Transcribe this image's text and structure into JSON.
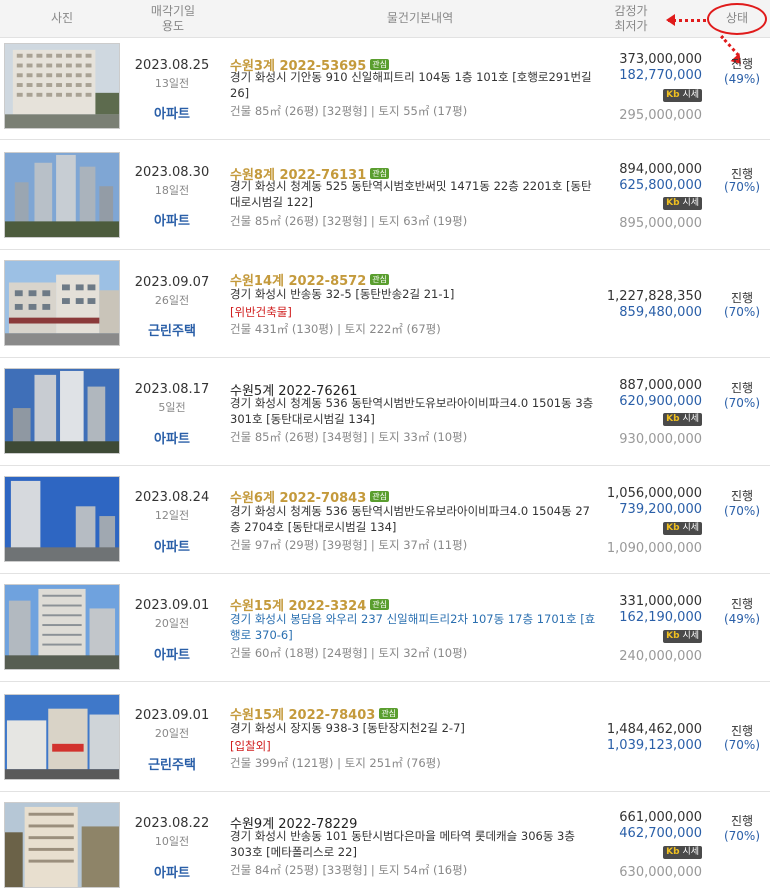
{
  "header": {
    "photo": "사진",
    "date_line1": "매각기일",
    "date_line2": "용도",
    "basic": "물건기본내역",
    "price_line1": "감정가",
    "price_line2": "최저가",
    "status": "상태"
  },
  "market_badge": {
    "kb": "Kb",
    "label": "시세"
  },
  "rows": [
    {
      "date": "2023.08.25",
      "days": "13일전",
      "usage": "아파트",
      "case": "수원3계 2022-53695",
      "tag": "관심",
      "addr": "경기 화성시 기안동 910 신일해피트리 104동 1층 101호 [호행로291번길 26]",
      "area": "건물 85㎡ (26평) [32평형]  |  토지 55㎡ (17평)",
      "appraisal": "373,000,000",
      "minimum": "182,770,000",
      "market": "295,000,000",
      "status": "진행",
      "pct": "(49%)"
    },
    {
      "date": "2023.08.30",
      "days": "18일전",
      "usage": "아파트",
      "case": "수원8계 2022-76131",
      "tag": "관심",
      "addr": "경기 화성시 청계동 525 동탄역시범호반써밋 1471동 22층 2201호 [동탄대로시범길 122]",
      "area": "건물 85㎡ (26평) [32평형]  |  토지 63㎡ (19평)",
      "appraisal": "894,000,000",
      "minimum": "625,800,000",
      "market": "895,000,000",
      "status": "진행",
      "pct": "(70%)"
    },
    {
      "date": "2023.09.07",
      "days": "26일전",
      "usage": "근린주택",
      "case": "수원14계 2022-8572",
      "tag": "관심",
      "addr": "경기 화성시 반송동 32-5 [동탄반송2길 21-1]",
      "warn": "[위반건축물]",
      "area": "건물 431㎡ (130평)  |  토지 222㎡ (67평)",
      "appraisal": "1,227,828,350",
      "minimum": "859,480,000",
      "status": "진행",
      "pct": "(70%)"
    },
    {
      "date": "2023.08.17",
      "days": "5일전",
      "usage": "아파트",
      "case": "수원5계 2022-76261",
      "addr": "경기 화성시 청계동 536 동탄역시범반도유보라아이비파크4.0 1501동 3층 301호 [동탄대로시범길 134]",
      "area": "건물 85㎡ (26평) [34평형]  |  토지 33㎡ (10평)",
      "appraisal": "887,000,000",
      "minimum": "620,900,000",
      "market": "930,000,000",
      "status": "진행",
      "pct": "(70%)"
    },
    {
      "date": "2023.08.24",
      "days": "12일전",
      "usage": "아파트",
      "case": "수원6계 2022-70843",
      "tag": "관심",
      "addr": "경기 화성시 청계동 536 동탄역시범반도유보라아이비파크4.0 1504동 27층 2704호 [동탄대로시범길 134]",
      "area": "건물 97㎡ (29평) [39평형]  |  토지 37㎡ (11평)",
      "appraisal": "1,056,000,000",
      "minimum": "739,200,000",
      "market": "1,090,000,000",
      "status": "진행",
      "pct": "(70%)"
    },
    {
      "date": "2023.09.01",
      "days": "20일전",
      "usage": "아파트",
      "case": "수원15계 2022-3324",
      "tag": "관심",
      "addr": "경기 화성시 봉담읍 와우리 237 신일해피트리2차 107동 17층 1701호 [효행로 370-6]",
      "area": "건물 60㎡ (18평) [24평형]  |  토지 32㎡ (10평)",
      "appraisal": "331,000,000",
      "minimum": "162,190,000",
      "market": "240,000,000",
      "status": "진행",
      "pct": "(49%)"
    },
    {
      "date": "2023.09.01",
      "days": "20일전",
      "usage": "근린주택",
      "case": "수원15계 2022-78403",
      "tag": "관심",
      "addr": "경기 화성시 장지동 938-3 [동탄장지천2길 2-7]",
      "warn": "[입찰외]",
      "area": "건물 399㎡ (121평)  |  토지 251㎡ (76평)",
      "appraisal": "1,484,462,000",
      "minimum": "1,039,123,000",
      "status": "진행",
      "pct": "(70%)"
    },
    {
      "date": "2023.08.22",
      "days": "10일전",
      "usage": "아파트",
      "case": "수원9계 2022-78229",
      "addr": "경기 화성시 반송동 101 동탄시범다은마을 메타역 롯데캐슬 306동 3층 303호 [메타폴리스로 22]",
      "area": "건물 84㎡ (25평) [33평형]  |  토지 54㎡ (16평)",
      "appraisal": "661,000,000",
      "minimum": "462,700,000",
      "market": "630,000,000",
      "status": "진행",
      "pct": "(70%)"
    }
  ]
}
